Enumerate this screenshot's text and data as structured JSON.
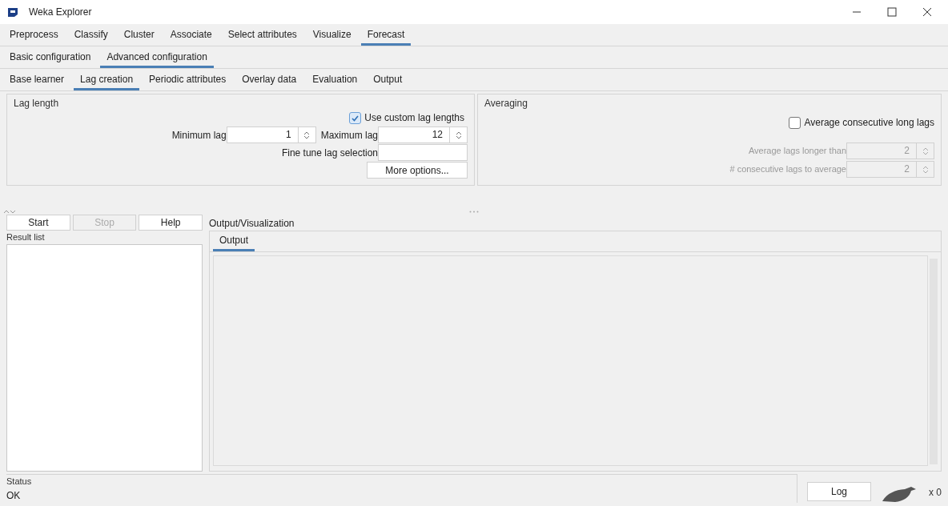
{
  "window": {
    "title": "Weka Explorer"
  },
  "main_tabs": [
    {
      "label": "Preprocess",
      "selected": false
    },
    {
      "label": "Classify",
      "selected": false
    },
    {
      "label": "Cluster",
      "selected": false
    },
    {
      "label": "Associate",
      "selected": false
    },
    {
      "label": "Select attributes",
      "selected": false
    },
    {
      "label": "Visualize",
      "selected": false
    },
    {
      "label": "Forecast",
      "selected": true
    }
  ],
  "config_tabs": [
    {
      "label": "Basic configuration",
      "selected": false
    },
    {
      "label": "Advanced configuration",
      "selected": true
    }
  ],
  "advanced_tabs": [
    {
      "label": "Base learner",
      "selected": false
    },
    {
      "label": "Lag creation",
      "selected": true
    },
    {
      "label": "Periodic attributes",
      "selected": false
    },
    {
      "label": "Overlay data",
      "selected": false
    },
    {
      "label": "Evaluation",
      "selected": false
    },
    {
      "label": "Output",
      "selected": false
    }
  ],
  "lag_length": {
    "title": "Lag length",
    "custom_checkbox": {
      "label": "Use custom lag lengths",
      "checked": true
    },
    "minimum_lag": {
      "label": "Minimum lag",
      "value": "1"
    },
    "maximum_lag": {
      "label": "Maximum lag",
      "value": "12"
    },
    "fine_tune": {
      "label": "Fine tune lag selection"
    },
    "more_button": "More options..."
  },
  "averaging": {
    "title": "Averaging",
    "checkbox": {
      "label": "Average consecutive long lags",
      "checked": false
    },
    "fields": [
      {
        "label": "Average lags longer than",
        "value": "2",
        "disabled": true
      },
      {
        "label": "# consecutive lags to average",
        "value": "2",
        "disabled": true
      }
    ]
  },
  "buttons": [
    {
      "label": "Start",
      "disabled": false
    },
    {
      "label": "Stop",
      "disabled": true
    },
    {
      "label": "Help",
      "disabled": false
    }
  ],
  "result_list": {
    "title": "Result list"
  },
  "output_panel": {
    "title": "Output/Visualization",
    "tabs": [
      {
        "label": "Output",
        "selected": true
      }
    ]
  },
  "status": {
    "title": "Status",
    "text": "OK",
    "log_button": "Log",
    "count": "x 0"
  }
}
